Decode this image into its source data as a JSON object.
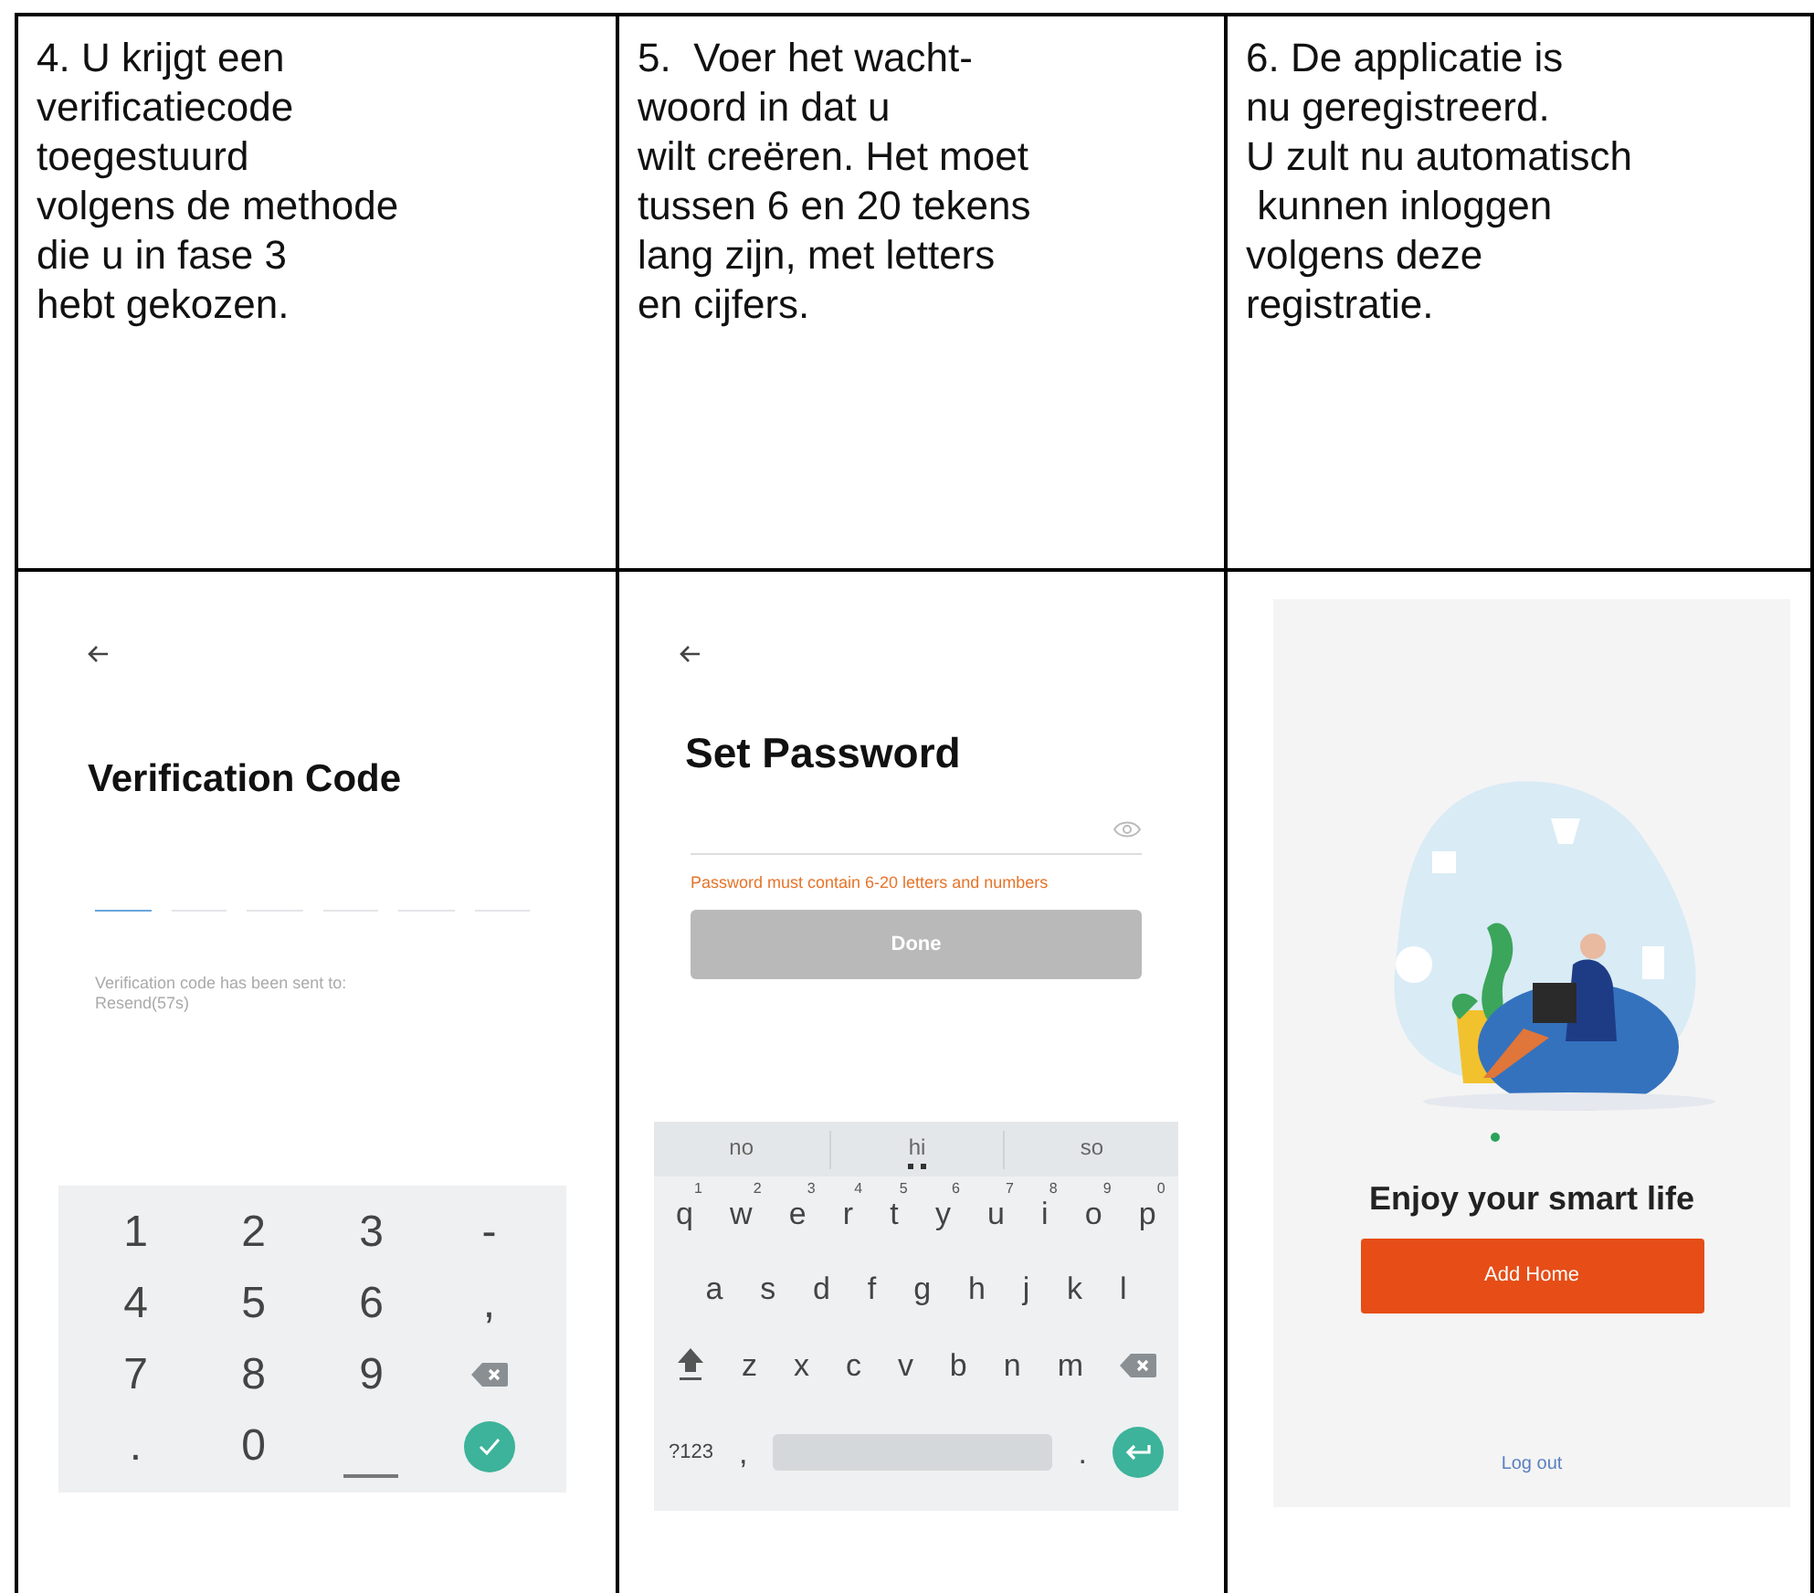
{
  "steps": [
    {
      "text": "4. U krijgt een\nverificatiecode\ntoegestuurd\nvolgens de methode\ndie u in fase 3\nhebt gekozen."
    },
    {
      "text": "5.  Voer het wacht-\nwoord in dat u\nwilt creëren. Het moet\ntussen 6 en 20 tekens\nlang zijn, met letters\nen cijfers."
    },
    {
      "text": "6. De applicatie is\nnu geregistreerd.\nU zult nu automatisch\n kunnen inloggen\nvolgens deze\nregistratie."
    }
  ],
  "verification_screen": {
    "title": "Verification Code",
    "code_slots": [
      {
        "active": true
      },
      {
        "active": false
      },
      {
        "active": false
      },
      {
        "active": false
      },
      {
        "active": false
      },
      {
        "active": false
      }
    ],
    "sent_text": "Verification code has been sent to:",
    "resend": "Resend(57s)",
    "keypad": [
      [
        {
          "kind": "char",
          "label": "1"
        },
        {
          "kind": "char",
          "label": "2"
        },
        {
          "kind": "char",
          "label": "3"
        },
        {
          "kind": "char",
          "label": "-"
        }
      ],
      [
        {
          "kind": "char",
          "label": "4"
        },
        {
          "kind": "char",
          "label": "5"
        },
        {
          "kind": "char",
          "label": "6"
        },
        {
          "kind": "char",
          "label": ","
        }
      ],
      [
        {
          "kind": "char",
          "label": "7"
        },
        {
          "kind": "char",
          "label": "8"
        },
        {
          "kind": "char",
          "label": "9"
        },
        {
          "kind": "backspace"
        }
      ],
      [
        {
          "kind": "char",
          "label": "."
        },
        {
          "kind": "char",
          "label": "0"
        },
        {
          "kind": "space"
        },
        {
          "kind": "done"
        }
      ]
    ]
  },
  "password_screen": {
    "title": "Set Password",
    "error": "Password must contain 6-20 letters and numbers",
    "button": "Done",
    "suggestions": [
      {
        "label": "no",
        "selected": false
      },
      {
        "label": "hi",
        "selected": true
      },
      {
        "label": "so",
        "selected": false
      }
    ],
    "keyboard": [
      [
        {
          "kind": "char",
          "label": "q",
          "hint": "1"
        },
        {
          "kind": "char",
          "label": "w",
          "hint": "2"
        },
        {
          "kind": "char",
          "label": "e",
          "hint": "3"
        },
        {
          "kind": "char",
          "label": "r",
          "hint": "4"
        },
        {
          "kind": "char",
          "label": "t",
          "hint": "5"
        },
        {
          "kind": "char",
          "label": "y",
          "hint": "6"
        },
        {
          "kind": "char",
          "label": "u",
          "hint": "7"
        },
        {
          "kind": "char",
          "label": "i",
          "hint": "8"
        },
        {
          "kind": "char",
          "label": "o",
          "hint": "9"
        },
        {
          "kind": "char",
          "label": "p",
          "hint": "0"
        }
      ],
      [
        {
          "kind": "char",
          "label": "a"
        },
        {
          "kind": "char",
          "label": "s"
        },
        {
          "kind": "char",
          "label": "d"
        },
        {
          "kind": "char",
          "label": "f"
        },
        {
          "kind": "char",
          "label": "g"
        },
        {
          "kind": "char",
          "label": "h"
        },
        {
          "kind": "char",
          "label": "j"
        },
        {
          "kind": "char",
          "label": "k"
        },
        {
          "kind": "char",
          "label": "l"
        }
      ],
      [
        {
          "kind": "shift"
        },
        {
          "kind": "char",
          "label": "z"
        },
        {
          "kind": "char",
          "label": "x"
        },
        {
          "kind": "char",
          "label": "c"
        },
        {
          "kind": "char",
          "label": "v"
        },
        {
          "kind": "char",
          "label": "b"
        },
        {
          "kind": "char",
          "label": "n"
        },
        {
          "kind": "char",
          "label": "m"
        },
        {
          "kind": "backspace"
        }
      ],
      [
        {
          "kind": "char",
          "label": "?123"
        },
        {
          "kind": "char",
          "label": ","
        },
        {
          "kind": "space"
        },
        {
          "kind": "char",
          "label": "."
        },
        {
          "kind": "enter"
        }
      ]
    ]
  },
  "home_screen": {
    "title": "Enjoy your smart life",
    "button": "Add Home",
    "link": "Log out"
  }
}
